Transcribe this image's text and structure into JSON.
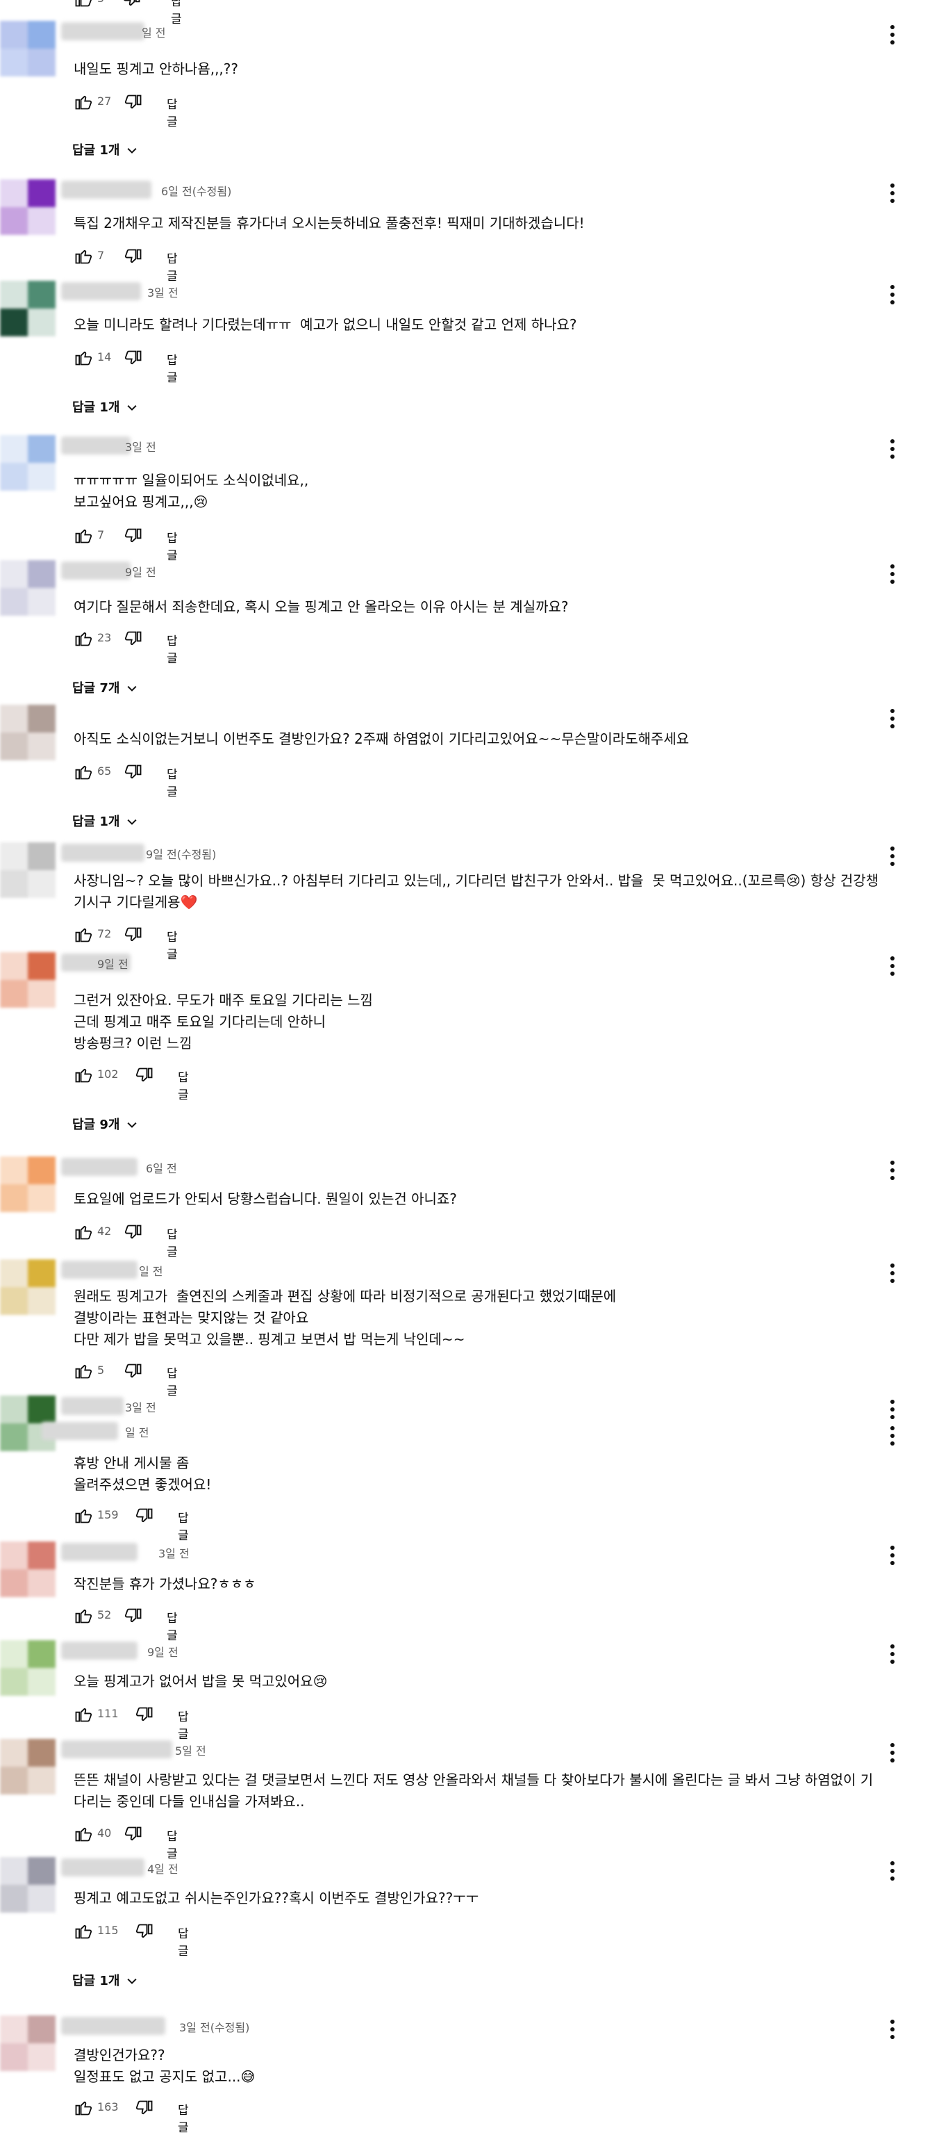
{
  "action": {
    "reply_label": "답글"
  },
  "colors": {
    "text": "#0f0f0f",
    "secondary": "#606060",
    "background": "#ffffff"
  },
  "top_partial": {
    "like_count": "5",
    "reply_label": "답글"
  },
  "comments": [
    {
      "meta": "일 전",
      "text": "내일도 핑계고 안하나욤,,,??",
      "likes": "27",
      "replies": "답글 1개"
    },
    {
      "meta": "6일 전(수정됨)",
      "text": "특집 2개채우고 제작진분들 휴가다녀 오시는듯하네요 풀충전후! 픽재미 기대하겠습니다!",
      "likes": "7",
      "replies": ""
    },
    {
      "meta": "3일 전",
      "text": "오늘 미니라도 할려나 기다렸는데ㅠㅠ  예고가 없으니 내일도 안할것 같고 언제 하나요?",
      "likes": "14",
      "replies": "답글 1개"
    },
    {
      "meta": "3일 전",
      "text": "ㅠㅠㅠㅠㅠ 일율이되어도 소식이없네요,,\n보고싶어요 핑계고,,,😢",
      "likes": "7",
      "replies": ""
    },
    {
      "meta": "9일 전",
      "text": "여기다 질문해서 죄송한데요, 혹시 오늘 핑계고 안 올라오는 이유 아시는 분 계실까요?",
      "likes": "23",
      "replies": "답글 7개"
    },
    {
      "meta": "",
      "text": "아직도 소식이없는거보니 이번주도 결방인가요? 2주째 하염없이 기다리고있어요~~무슨말이라도해주세요",
      "likes": "65",
      "replies": "답글 1개"
    },
    {
      "meta": "9일 전(수정됨)",
      "text": "사장니임~? 오늘 많이 바쁘신가요..? 아침부터 기다리고 있는데,, 기다리던 밥친구가 안와서.. 밥을  못 먹고있어요..(꼬르륵😢) 항상 건강챙\n기시구 기다릴게용❤️",
      "likes": "72",
      "replies": ""
    },
    {
      "meta": "9일 전",
      "text": "그런거 있잔아요. 무도가 매주 토요일 기다리는 느낌\n근데 핑계고 매주 토요일 기다리는데 안하니\n방송펑크? 이런 느낌",
      "likes": "102",
      "replies": "답글 9개"
    },
    {
      "meta": "6일 전",
      "text": "토요일에 업로드가 안되서 당황스럽습니다. 뭔일이 있는건 아니죠?",
      "likes": "42",
      "replies": ""
    },
    {
      "meta": "일 전",
      "text": "원래도 핑계고가  출연진의 스케줄과 편집 상황에 따라 비정기적으로 공개된다고 했었기때문에\n결방이라는 표현과는 맞지않는 것 같아요\n다만 제가 밥을 못먹고 있을뿐.. 핑계고 보면서 밥 먹는게 낙인데~~",
      "likes": "5",
      "replies": ""
    },
    {
      "meta": "3일 전",
      "meta2": "일 전",
      "text": "휴방 안내 게시물 좀\n올려주셨으면 좋겠어요!",
      "likes": "159",
      "replies": ""
    },
    {
      "meta": "3일 전",
      "text": "작진분들 휴가 가셨나요?ㅎㅎㅎ",
      "likes": "52",
      "replies": ""
    },
    {
      "meta": "9일 전",
      "text": "오늘 핑계고가 없어서 밥을 못 먹고있어요😢",
      "likes": "111",
      "replies": ""
    },
    {
      "meta": "5일 전",
      "text": "뜬뜬 채널이 사랑받고 있다는 걸 댓글보면서 느낀다 저도 영상 안올라와서 채널들 다 찾아보다가 불시에 올린다는 글 봐서 그냥 하염없이 기\n다리는 중인데 다들 인내심을 가져봐요..",
      "likes": "40",
      "replies": ""
    },
    {
      "meta": "4일 전",
      "text": "핑계고 예고도없고 쉬시는주인가요??혹시 이번주도 결방인가요??ㅜㅜ",
      "likes": "115",
      "replies": "답글 1개"
    },
    {
      "meta": "3일 전(수정됨)",
      "text": "결방인건가요??\n일정표도 없고 공지도 없고...😅",
      "likes": "163",
      "replies": ""
    }
  ]
}
